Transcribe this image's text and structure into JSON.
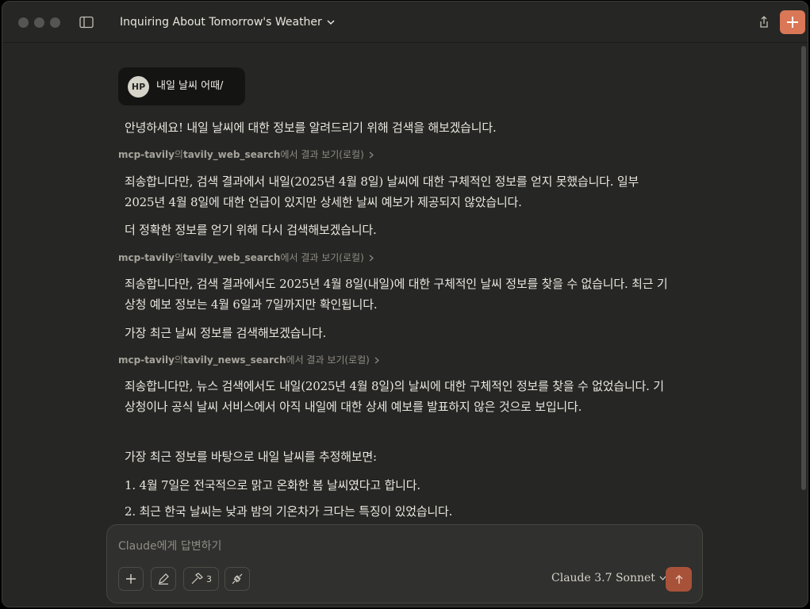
{
  "window": {
    "title": "Inquiring About Tomorrow's Weather"
  },
  "messages": {
    "user": {
      "initials": "HP",
      "text": "내일 날씨 어때/"
    },
    "p1": "안녕하세요! 내일 날씨에 대한 정보를 알려드리기 위해 검색을 해보겠습니다.",
    "tool1": {
      "server": "mcp-tavily",
      "particle": "의 ",
      "tool": "tavily_web_search",
      "suffix": "에서 결과 보기(로컬)"
    },
    "p2": "죄송합니다만, 검색 결과에서 내일(2025년 4월 8일) 날씨에 대한 구체적인 정보를 얻지 못했습니다. 일부 2025년 4월 8일에 대한 언급이 있지만 상세한 날씨 예보가 제공되지 않았습니다.",
    "p3": "더 정확한 정보를 얻기 위해 다시 검색해보겠습니다.",
    "tool2": {
      "server": "mcp-tavily",
      "particle": "의 ",
      "tool": "tavily_web_search",
      "suffix": "에서 결과 보기(로컬)"
    },
    "p4": "죄송합니다만, 검색 결과에서도 2025년 4월 8일(내일)에 대한 구체적인 날씨 정보를 찾을 수 없습니다. 최근 기상청 예보 정보는 4월 6일과 7일까지만 확인됩니다.",
    "p5": "가장 최근 날씨 정보를 검색해보겠습니다.",
    "tool3": {
      "server": "mcp-tavily",
      "particle": "의 ",
      "tool": "tavily_news_search",
      "suffix": "에서 결과 보기(로컬)"
    },
    "p6": "죄송합니다만, 뉴스 검색에서도 내일(2025년 4월 8일)의 날씨에 대한 구체적인 정보를 찾을 수 없었습니다. 기상청이나 공식 날씨 서비스에서 아직 내일에 대한 상세 예보를 발표하지 않은 것으로 보입니다.",
    "p7": "가장 최근 정보를 바탕으로 내일 날씨를 추정해보면:",
    "list": [
      "1. 4월 7일은 전국적으로 맑고 온화한 봄 날씨였다고 합니다.",
      "2. 최근 한국 날씨는 낮과 밤의 기온차가 크다는 특징이 있었습니다."
    ]
  },
  "composer": {
    "placeholder": "Claude에게 답변하기",
    "tools_count": "3",
    "model": "Claude 3.7 Sonnet"
  },
  "colors": {
    "accent": "#d97757",
    "send": "#a8523a",
    "background": "#262624"
  },
  "icons": [
    "sidebar-toggle-icon",
    "chevron-down-icon",
    "share-icon",
    "plus-icon",
    "pen-icon",
    "hammer-icon",
    "plug-icon",
    "arrow-up-icon",
    "chevron-right-icon"
  ]
}
